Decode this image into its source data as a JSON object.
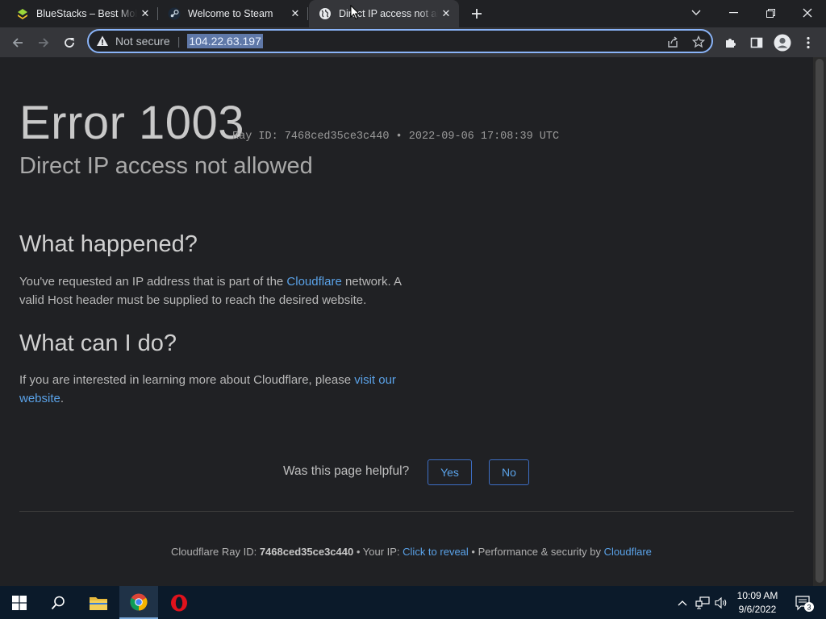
{
  "browser": {
    "tabs": [
      {
        "title": "BlueStacks – Best Mobile",
        "favicon": "bluestacks-icon",
        "active": false
      },
      {
        "title": "Welcome to Steam",
        "favicon": "steam-icon",
        "active": false
      },
      {
        "title": "Direct IP access not allowed",
        "favicon": "globe-icon",
        "active": true
      }
    ],
    "address_bar": {
      "security_label": "Not secure",
      "url": "104.22.63.197"
    }
  },
  "page": {
    "error_code": "Error 1003",
    "ray_id_line": "Ray ID: 7468ced35ce3c440",
    "bullet": "•",
    "timestamp": "2022-09-06 17:08:39 UTC",
    "error_title": "Direct IP access not allowed",
    "what_happened": {
      "heading": "What happened?",
      "text_before": "You've requested an IP address that is part of the ",
      "link": "Cloudflare",
      "text_after": " network. A valid Host header must be supplied to reach the desired website."
    },
    "what_can_i_do": {
      "heading": "What can I do?",
      "text_before": "If you are interested in learning more about Cloudflare, please ",
      "link": "visit our website",
      "text_after": "."
    },
    "feedback": {
      "question": "Was this page helpful?",
      "yes": "Yes",
      "no": "No"
    },
    "footer": {
      "ray_label": "Cloudflare Ray ID: ",
      "ray_value": "7468ced35ce3c440",
      "ip_label": " • Your IP: ",
      "ip_link": "Click to reveal",
      "perf_label": " • Performance & security by ",
      "perf_link": "Cloudflare"
    }
  },
  "taskbar": {
    "time": "10:09 AM",
    "date": "9/6/2022",
    "notification_count": "3"
  },
  "colors": {
    "link": "#5aa2e8",
    "focus_ring": "#8ab4f8",
    "page_bg": "#202124",
    "taskbar_bg": "#0b1a2a"
  }
}
